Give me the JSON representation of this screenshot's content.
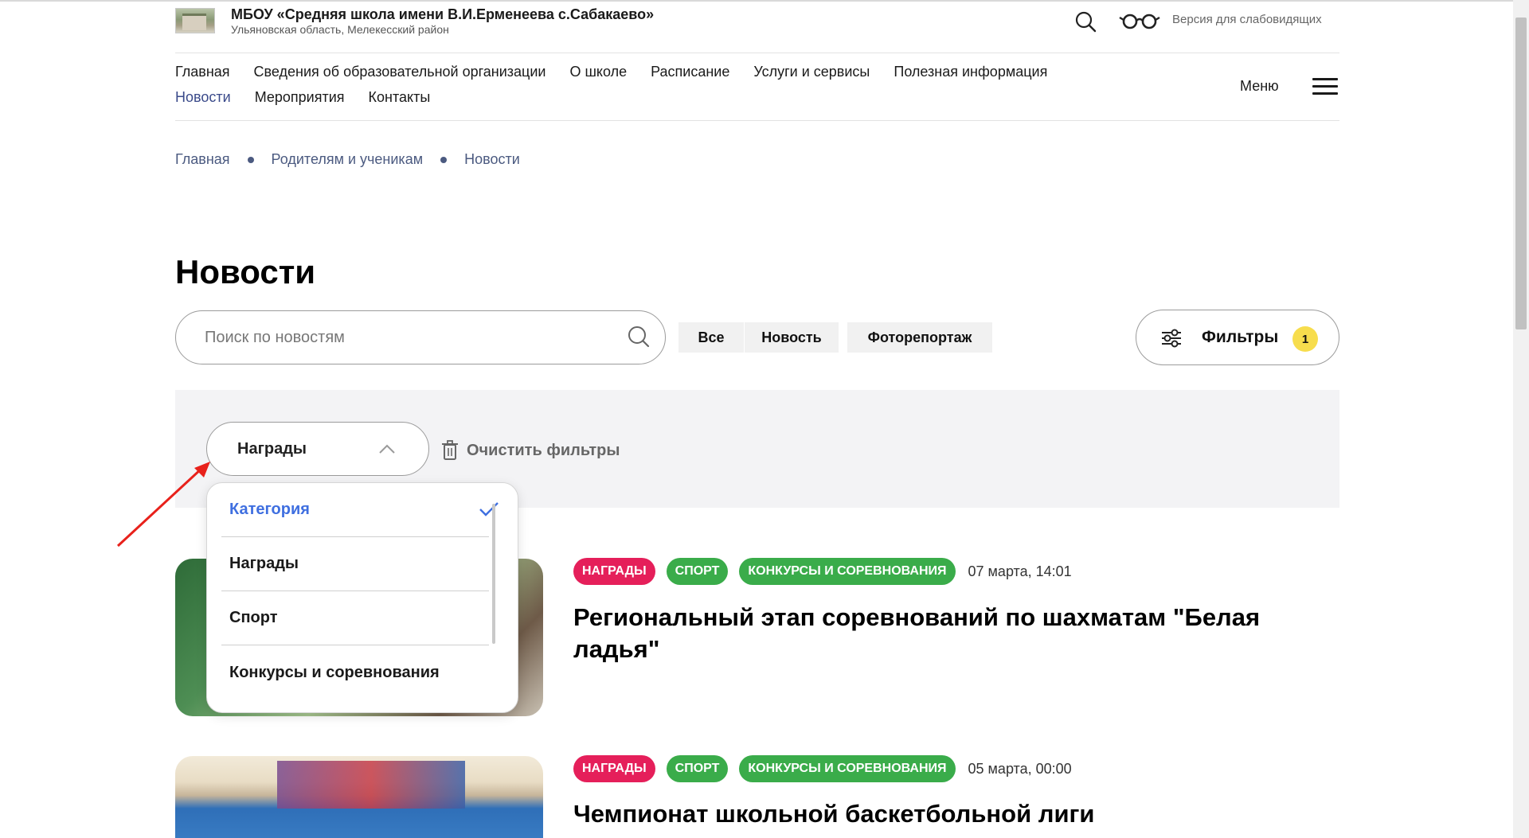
{
  "header": {
    "org_name": "МБОУ «Средняя школа имени В.И.Ерменеева с.Сабакаево»",
    "org_region": "Ульяновская область, Мелекесский район",
    "vision_mode_label": "Версия для слабовидящих"
  },
  "nav": {
    "row1": [
      "Главная",
      "Сведения об образовательной организации",
      "О школе",
      "Расписание",
      "Услуги и сервисы",
      "Полезная информация"
    ],
    "row2": [
      "Новости",
      "Мероприятия",
      "Контакты"
    ],
    "menu_label": "Меню"
  },
  "breadcrumb": [
    "Главная",
    "Родителям и ученикам",
    "Новости"
  ],
  "page_title": "Новости",
  "search": {
    "placeholder": "Поиск по новостям",
    "value": ""
  },
  "type_chips": [
    "Все",
    "Новость",
    "Фоторепортаж"
  ],
  "filters_button": {
    "label": "Фильтры",
    "count": "1"
  },
  "filter_panel": {
    "dropdown_value": "Награды",
    "clear_label": "Очистить фильтры",
    "options": [
      {
        "label": "Категория",
        "selected": true
      },
      {
        "label": "Награды",
        "selected": false
      },
      {
        "label": "Спорт",
        "selected": false
      },
      {
        "label": "Конкурсы и соревнования",
        "selected": false
      }
    ]
  },
  "news": [
    {
      "tags": [
        "НАГРАДЫ",
        "СПОРТ",
        "КОНКУРСЫ И СОРЕВНОВАНИЯ"
      ],
      "date": "07 марта, 14:01",
      "title": "Региональный этап соревнований по шахматам \"Белая ладья\""
    },
    {
      "tags": [
        "НАГРАДЫ",
        "СПОРТ",
        "КОНКУРСЫ И СОРЕВНОВАНИЯ"
      ],
      "date": "05 марта, 00:00",
      "title": "Чемпионат школьной баскетбольной лиги"
    }
  ],
  "colors": {
    "accent_blue": "#3f6fe0",
    "nav_active": "#3a4a8a",
    "tag_red": "#e51f5a",
    "tag_green": "#3aac4a",
    "badge_yellow": "#f7dd4d",
    "annotation_arrow": "#e8211b"
  }
}
